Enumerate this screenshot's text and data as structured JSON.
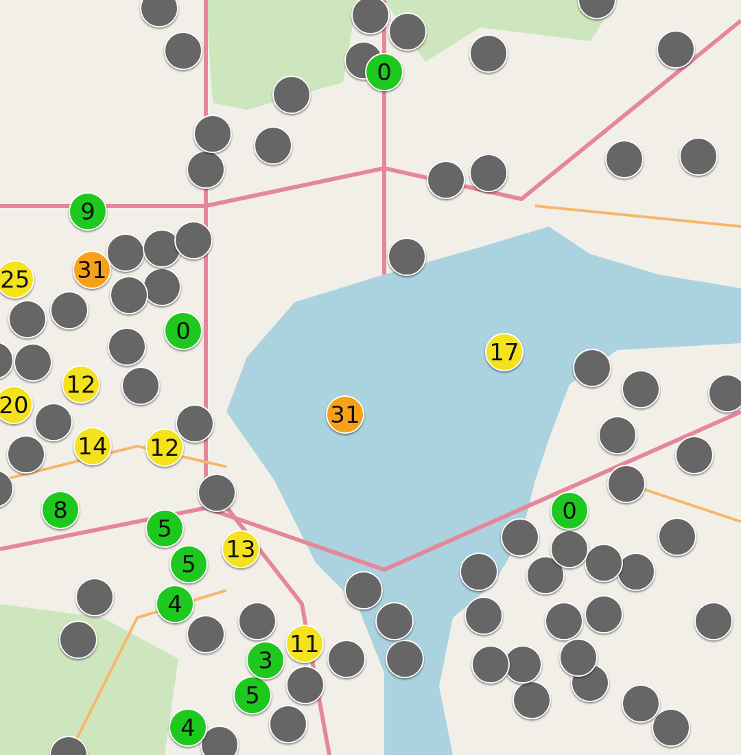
{
  "map": {
    "markers": [
      {
        "label": "0",
        "color": "#1ec81e"
      },
      {
        "label": "9",
        "color": "#1ec81e"
      },
      {
        "label": "31",
        "color": "#f7a11a"
      },
      {
        "label": "25",
        "color": "#f3e21c"
      },
      {
        "label": "0",
        "color": "#1ec81e"
      },
      {
        "label": "17",
        "color": "#f3e21c"
      },
      {
        "label": "12",
        "color": "#f3e21c"
      },
      {
        "label": "20",
        "color": "#f3e21c"
      },
      {
        "label": "31",
        "color": "#f7a11a"
      },
      {
        "label": "14",
        "color": "#f3e21c"
      },
      {
        "label": "12",
        "color": "#f3e21c"
      },
      {
        "label": "8",
        "color": "#1ec81e"
      },
      {
        "label": "0",
        "color": "#1ec81e"
      },
      {
        "label": "5",
        "color": "#1ec81e"
      },
      {
        "label": "5",
        "color": "#1ec81e"
      },
      {
        "label": "13",
        "color": "#f3e21c"
      },
      {
        "label": "4",
        "color": "#1ec81e"
      },
      {
        "label": "11",
        "color": "#f3e21c"
      },
      {
        "label": "3",
        "color": "#1ec81e"
      },
      {
        "label": "5",
        "color": "#1ec81e"
      },
      {
        "label": "4",
        "color": "#1ec81e"
      },
      {
        "color": "#666666"
      },
      {
        "color": "#666666"
      },
      {
        "color": "#666666"
      },
      {
        "color": "#666666"
      },
      {
        "color": "#666666"
      },
      {
        "color": "#666666"
      },
      {
        "color": "#666666"
      },
      {
        "color": "#666666"
      },
      {
        "color": "#666666"
      },
      {
        "color": "#666666"
      },
      {
        "color": "#666666"
      },
      {
        "color": "#666666"
      },
      {
        "color": "#666666"
      },
      {
        "color": "#666666"
      },
      {
        "color": "#666666"
      },
      {
        "color": "#666666"
      },
      {
        "color": "#666666"
      },
      {
        "color": "#666666"
      },
      {
        "color": "#666666"
      },
      {
        "color": "#666666"
      },
      {
        "color": "#666666"
      },
      {
        "color": "#666666"
      },
      {
        "color": "#666666"
      },
      {
        "color": "#666666"
      },
      {
        "color": "#666666"
      },
      {
        "color": "#666666"
      },
      {
        "color": "#666666"
      },
      {
        "color": "#666666"
      },
      {
        "color": "#666666"
      },
      {
        "color": "#666666"
      },
      {
        "color": "#666666"
      },
      {
        "color": "#666666"
      },
      {
        "color": "#666666"
      },
      {
        "color": "#666666"
      },
      {
        "color": "#666666"
      },
      {
        "color": "#666666"
      },
      {
        "color": "#666666"
      },
      {
        "color": "#666666"
      },
      {
        "color": "#666666"
      },
      {
        "color": "#666666"
      },
      {
        "color": "#666666"
      },
      {
        "color": "#666666"
      },
      {
        "color": "#666666"
      },
      {
        "color": "#666666"
      },
      {
        "color": "#666666"
      },
      {
        "color": "#666666"
      },
      {
        "color": "#666666"
      },
      {
        "color": "#666666"
      },
      {
        "color": "#666666"
      },
      {
        "color": "#666666"
      },
      {
        "color": "#666666"
      },
      {
        "color": "#666666"
      },
      {
        "color": "#666666"
      },
      {
        "color": "#666666"
      },
      {
        "color": "#666666"
      },
      {
        "color": "#666666"
      },
      {
        "color": "#666666"
      },
      {
        "color": "#666666"
      },
      {
        "color": "#666666"
      },
      {
        "color": "#666666"
      },
      {
        "color": "#666666"
      },
      {
        "color": "#666666"
      },
      {
        "color": "#666666"
      },
      {
        "color": "#666666"
      },
      {
        "color": "#666666"
      },
      {
        "color": "#666666"
      },
      {
        "color": "#666666"
      },
      {
        "color": "#666666"
      },
      {
        "color": "#666666"
      }
    ]
  }
}
